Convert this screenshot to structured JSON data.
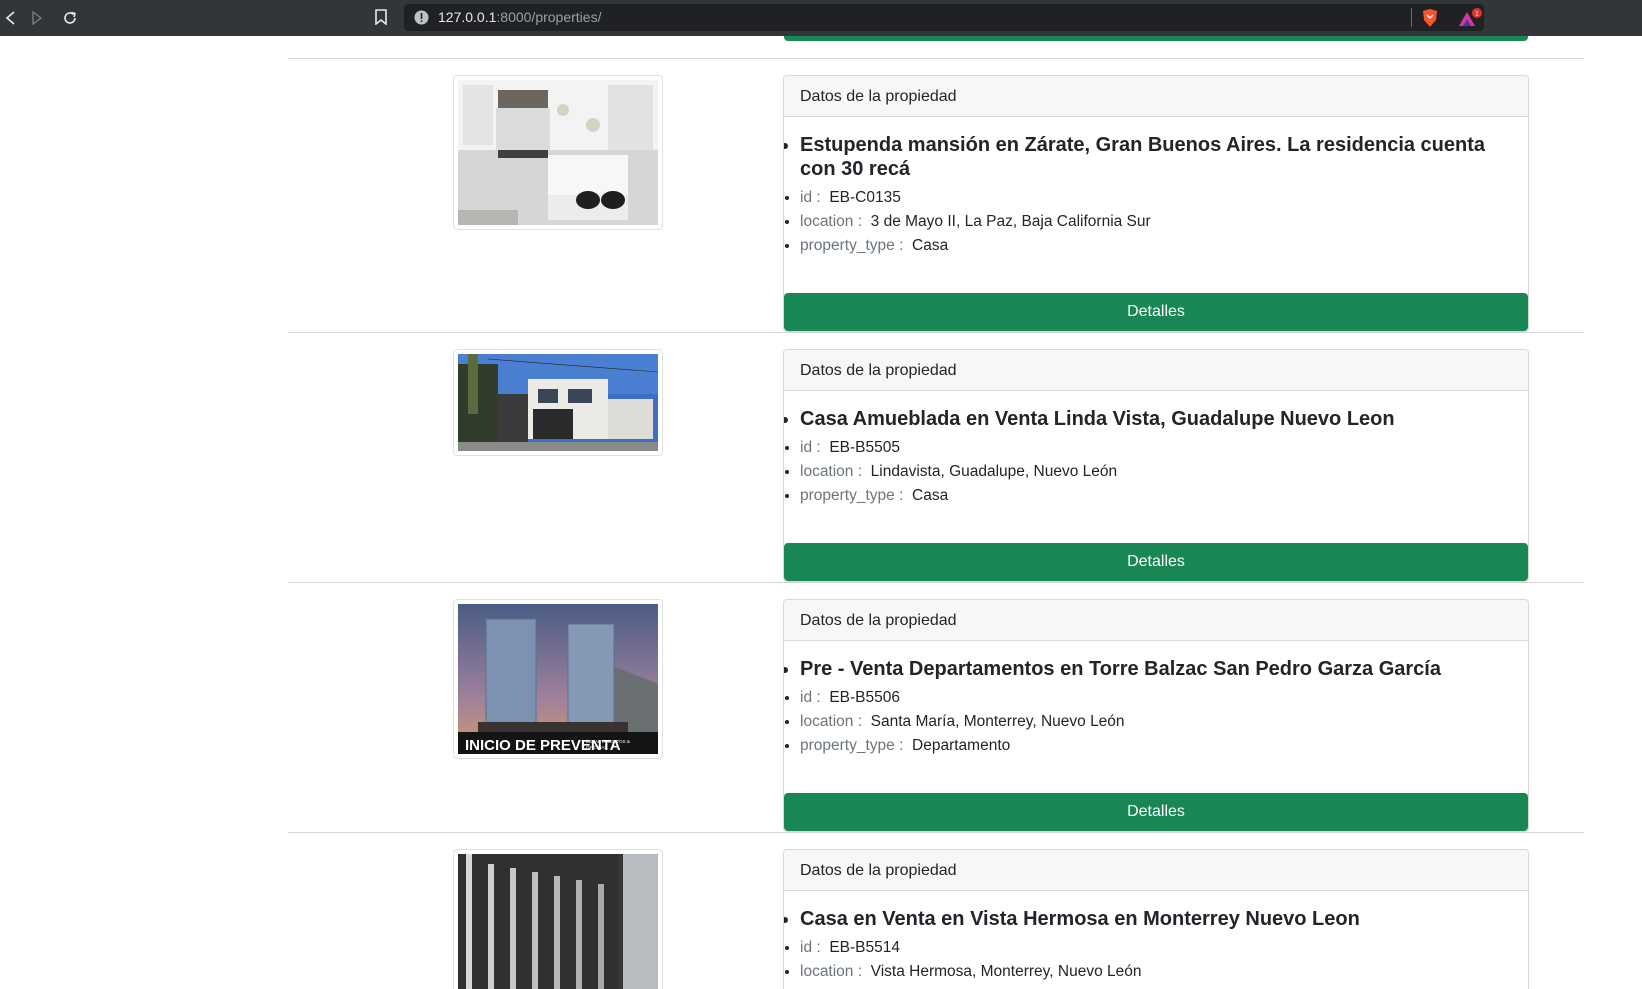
{
  "browser": {
    "url_host": "127.0.0.1",
    "url_path": ":8000/properties/"
  },
  "card_header": "Datos de la propiedad",
  "labels": {
    "id": "id :",
    "location": "location :",
    "property_type": "property_type :"
  },
  "button_label": "Detalles",
  "properties": [
    {
      "title": "Estupenda mansión en Zárate, Gran Buenos Aires. La residencia cuenta con 30 recá",
      "id": "EB-C0135",
      "location": "3 de Mayo II, La Paz, Baja California Sur",
      "property_type": "Casa"
    },
    {
      "title": "Casa Amueblada en Venta Linda Vista, Guadalupe Nuevo Leon",
      "id": "EB-B5505",
      "location": "Lindavista, Guadalupe, Nuevo León",
      "property_type": "Casa"
    },
    {
      "title": "Pre - Venta Departamentos en Torre Balzac San Pedro Garza García",
      "id": "EB-B5506",
      "location": "Santa María, Monterrey, Nuevo León",
      "property_type": "Departamento",
      "image_caption": "INICIO DE PREVENTA",
      "image_caption_small_1": "DEPARTAMENTOS &",
      "image_caption_small_2": "OFICINAS"
    },
    {
      "title": "Casa en Venta en Vista Hermosa en Monterrey Nuevo Leon",
      "id": "EB-B5514",
      "location": "Vista Hermosa, Monterrey, Nuevo León"
    }
  ],
  "colors": {
    "button": "#198754",
    "browser_bar": "#323639"
  }
}
